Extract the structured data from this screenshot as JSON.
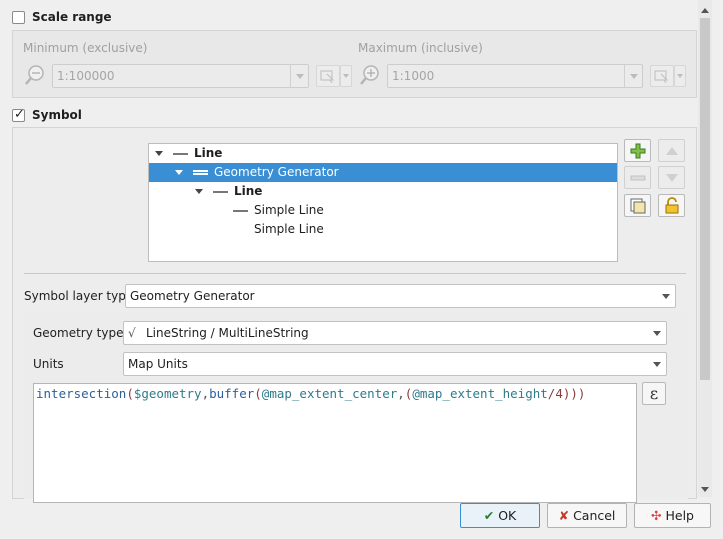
{
  "scale_range": {
    "title": "Scale range",
    "checked": false,
    "minimum_label": "Minimum (exclusive)",
    "minimum_value": "1:100000",
    "maximum_label": "Maximum (inclusive)",
    "maximum_value": "1:1000"
  },
  "symbol": {
    "title": "Symbol",
    "checked": true,
    "tree": [
      {
        "label": "Line",
        "bold": true,
        "expanded": true
      },
      {
        "label": "Geometry Generator",
        "bold": false,
        "selected": true,
        "expanded": true
      },
      {
        "label": "Line",
        "bold": true,
        "expanded": true
      },
      {
        "label": "Simple Line",
        "bold": false
      },
      {
        "label": "Simple Line",
        "bold": false
      }
    ],
    "side_buttons": [
      "add-layer",
      "remove-layer",
      "move-up",
      "move-down",
      "duplicate-layer",
      "lock-color"
    ]
  },
  "symbol_layer_type": {
    "label": "Symbol layer type",
    "value": "Geometry Generator"
  },
  "geometry_type": {
    "label": "Geometry type",
    "value": "LineString / MultiLineString",
    "icon": "√"
  },
  "units": {
    "label": "Units",
    "value": "Map Units"
  },
  "expression": {
    "parts": [
      "intersection",
      "(",
      "$geometry",
      ",",
      "buffer",
      "(",
      "@map_extent_center",
      ",",
      "(",
      "@map_extent_height",
      "/",
      "4",
      ")))"
    ],
    "button_symbol": "ε"
  },
  "buttons": {
    "ok": "OK",
    "cancel": "Cancel",
    "help": "Help"
  },
  "colors": {
    "selection": "#3a8fd4",
    "function": "#2d5f9a",
    "variable": "#2d7b8b",
    "number": "#8b3a3a"
  }
}
